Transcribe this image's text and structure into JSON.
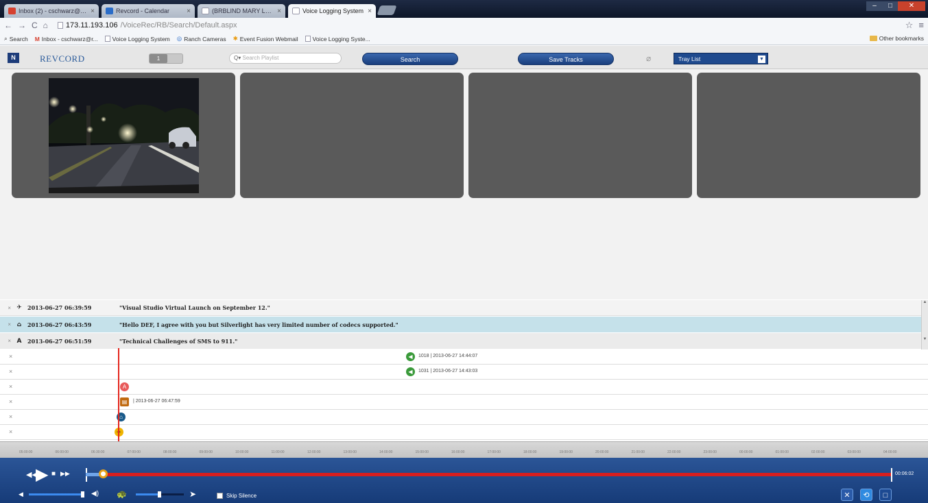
{
  "browser": {
    "tabs": [
      {
        "title": "Inbox (2) - cschwarz@wi...",
        "favicon_color": "#d6402f"
      },
      {
        "title": "Revcord - Calendar",
        "favicon_color": "#2a6cc8"
      },
      {
        "title": "(BRBLIND MARY LOU &...",
        "favicon_color": "#ffffff"
      },
      {
        "title": "Voice Logging System",
        "favicon_color": "#ffffff",
        "active": true
      }
    ],
    "url_host": "173.11.193.106",
    "url_path": "/VoiceRec/RB/Search/Default.aspx",
    "bookmarks": [
      "Search",
      "Inbox - cschwarz@r...",
      "Voice Logging System",
      "Ranch Cameras",
      "Event Fusion Webmail",
      "Voice Logging Syste..."
    ],
    "other_bookmarks": "Other bookmarks"
  },
  "toolbar": {
    "logo_letter": "N",
    "brand": "REVCORD",
    "toggle_label": "1",
    "search_placeholder": "Search Playlist",
    "search_button": "Search",
    "save_tracks_button": "Save Tracks",
    "tray_list": "Tray List"
  },
  "notes": [
    {
      "icon": "car-icon",
      "glyph": "✈",
      "timestamp": "2013-06-27 06:39:59",
      "text": "\"Visual Studio Virtual Launch on September 12.\""
    },
    {
      "icon": "message-icon",
      "glyph": "⌂",
      "timestamp": "2013-06-27 06:43:59",
      "text": "\"Hello DEF, I agree with you but Silverlight has very limited number of codecs supported.\"",
      "selected": true
    },
    {
      "icon": "text-icon",
      "glyph": "A",
      "timestamp": "2013-06-27 06:51:59",
      "text": "\"Technical Challenges of SMS to 911.\""
    }
  ],
  "lanes": [
    {
      "marker_label": "1018 | 2013-06-27 14:44:07",
      "marker_color": "#3a9a3a"
    },
    {
      "marker_label": "1031 | 2013-06-27 14:43:03",
      "marker_color": "#3a9a3a"
    },
    {
      "marker_label": "",
      "marker_color": "#e85a5a"
    },
    {
      "marker_label": "| 2013-06-27 06:47:59",
      "marker_color": "#c06a10"
    },
    {
      "marker_label": "",
      "marker_color": "#1a5a8a"
    },
    {
      "marker_label": "",
      "marker_color": "#f0b400"
    }
  ],
  "ruler_ticks": [
    "05:00:00",
    "06:00:00",
    "06:30:00",
    "07:00:00",
    "08:00:00",
    "09:00:00",
    "10:00:00",
    "11:00:00",
    "12:00:00",
    "13:00:00",
    "14:00:00",
    "15:00:00",
    "16:00:00",
    "17:00:00",
    "18:00:00",
    "19:00:00",
    "20:00:00",
    "21:00:00",
    "22:00:00",
    "23:00:00",
    "00:00:00",
    "01:00:00",
    "02:00:00",
    "03:00:00",
    "04:00:00"
  ],
  "player": {
    "end_time": "00:06:02",
    "skip_silence": "Skip Silence",
    "progress_fraction": 0.02,
    "volume_fraction": 0.7,
    "speed_fraction": 0.5
  }
}
